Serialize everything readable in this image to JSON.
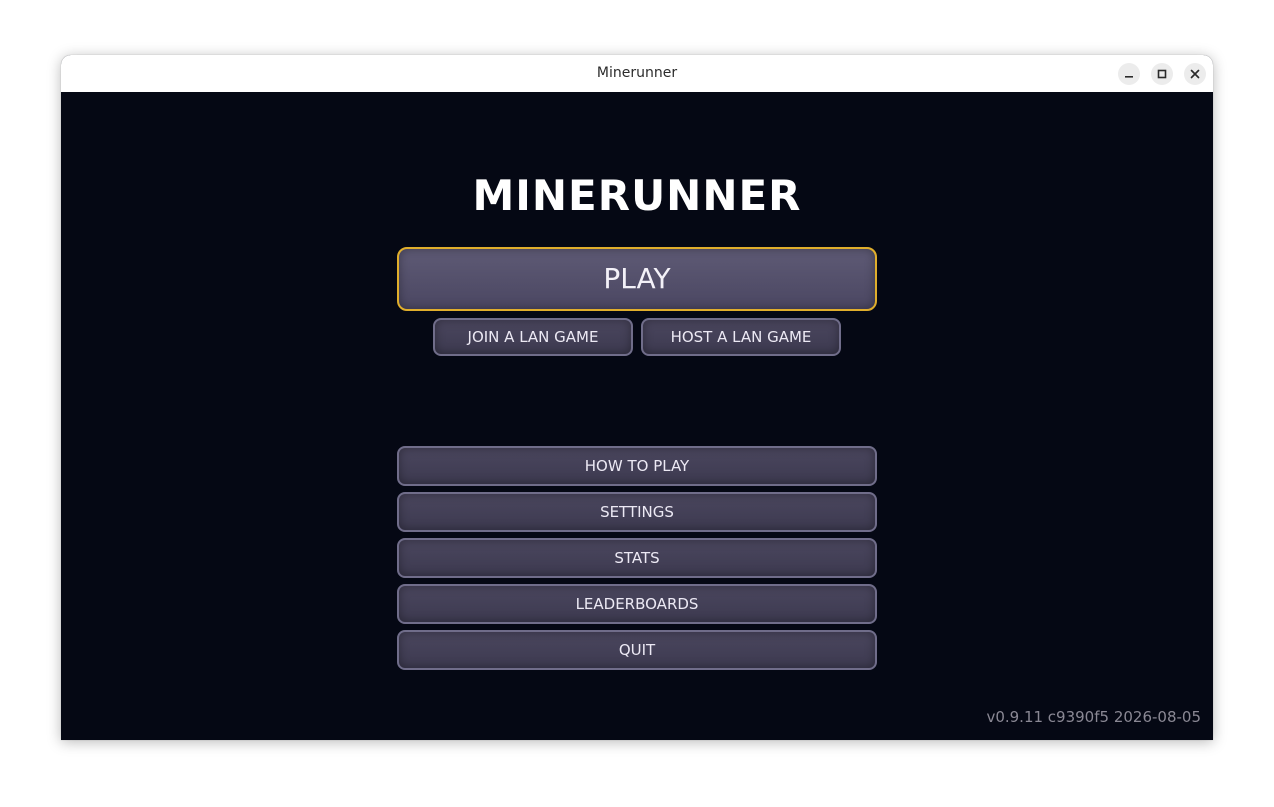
{
  "window": {
    "title": "Minerunner",
    "controls": {
      "minimize_icon": "minimize-icon",
      "maximize_icon": "maximize-icon",
      "close_icon": "close-icon"
    }
  },
  "game": {
    "title": "MINERUNNER",
    "play_label": "PLAY",
    "lan": {
      "join_label": "JOIN A LAN GAME",
      "host_label": "HOST A LAN GAME"
    },
    "menu": {
      "how_to_play": "HOW TO PLAY",
      "settings": "SETTINGS",
      "stats": "STATS",
      "leaderboards": "LEADERBOARDS",
      "quit": "QUIT"
    },
    "version": "v0.9.11 c9390f5 2026-08-05"
  },
  "colors": {
    "background": "#050814",
    "button_fill": "#44405a",
    "button_border": "#706d8a",
    "play_border": "#e0ae2c",
    "version_text": "#8a8894"
  }
}
